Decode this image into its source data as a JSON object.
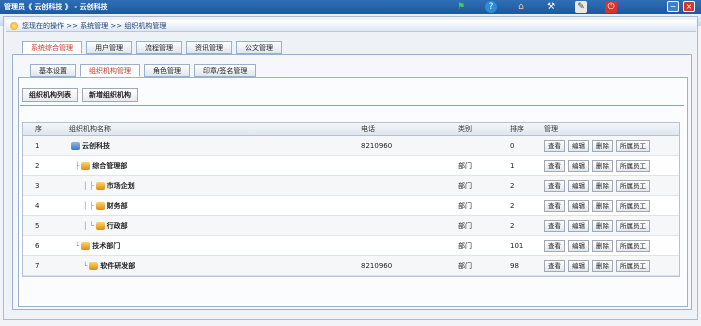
{
  "window": {
    "title": "管理员《 云创科技 》 - 云创科技"
  },
  "toolbar_icons": [
    "flag-icon",
    "help-icon",
    "home-icon",
    "tools-icon",
    "edit-icon",
    "exit-icon"
  ],
  "window_buttons": [
    "minimize",
    "close"
  ],
  "breadcrumb": "您现在的操作 >> 系统管理 >> 组织机构管理",
  "main_tabs": [
    {
      "label": "系统综合管理",
      "active": true
    },
    {
      "label": "用户管理",
      "active": false
    },
    {
      "label": "流程管理",
      "active": false
    },
    {
      "label": "资讯管理",
      "active": false
    },
    {
      "label": "公文管理",
      "active": false
    }
  ],
  "sub_tabs": [
    {
      "label": "基本设置",
      "active": false
    },
    {
      "label": "组织机构管理",
      "active": true
    },
    {
      "label": "角色管理",
      "active": false
    },
    {
      "label": "印章/签名管理",
      "active": false
    }
  ],
  "actions": [
    "组织机构列表",
    "新增组织机构"
  ],
  "table": {
    "headers": [
      "序",
      "组织机构名称",
      "电话",
      "类别",
      "排序",
      "管理"
    ],
    "row_actions": [
      "查看",
      "编辑",
      "删除",
      "所属员工"
    ],
    "rows": [
      {
        "no": "1",
        "prefix": "",
        "name": "云创科技",
        "phone": "8210960",
        "type": "",
        "sort": "0"
      },
      {
        "no": "2",
        "prefix": "├",
        "name": "综合管理部",
        "phone": "",
        "type": "部门",
        "sort": "1"
      },
      {
        "no": "3",
        "prefix": "│ ├",
        "name": "市场企划",
        "phone": "",
        "type": "部门",
        "sort": "2"
      },
      {
        "no": "4",
        "prefix": "│ ├",
        "name": "财务部",
        "phone": "",
        "type": "部门",
        "sort": "2"
      },
      {
        "no": "5",
        "prefix": "│ └",
        "name": "行政部",
        "phone": "",
        "type": "部门",
        "sort": "2"
      },
      {
        "no": "6",
        "prefix": "└",
        "name": "技术部门",
        "phone": "",
        "type": "部门",
        "sort": "101"
      },
      {
        "no": "7",
        "prefix": "  └",
        "name": "软件研发部",
        "phone": "8210960",
        "type": "部门",
        "sort": "98"
      }
    ]
  },
  "colors": {
    "titlebar": "#1d57a0",
    "active_tab_text": "#c0392b",
    "minimize_btn": "#3d7fd0",
    "close_btn": "#d9342b"
  }
}
